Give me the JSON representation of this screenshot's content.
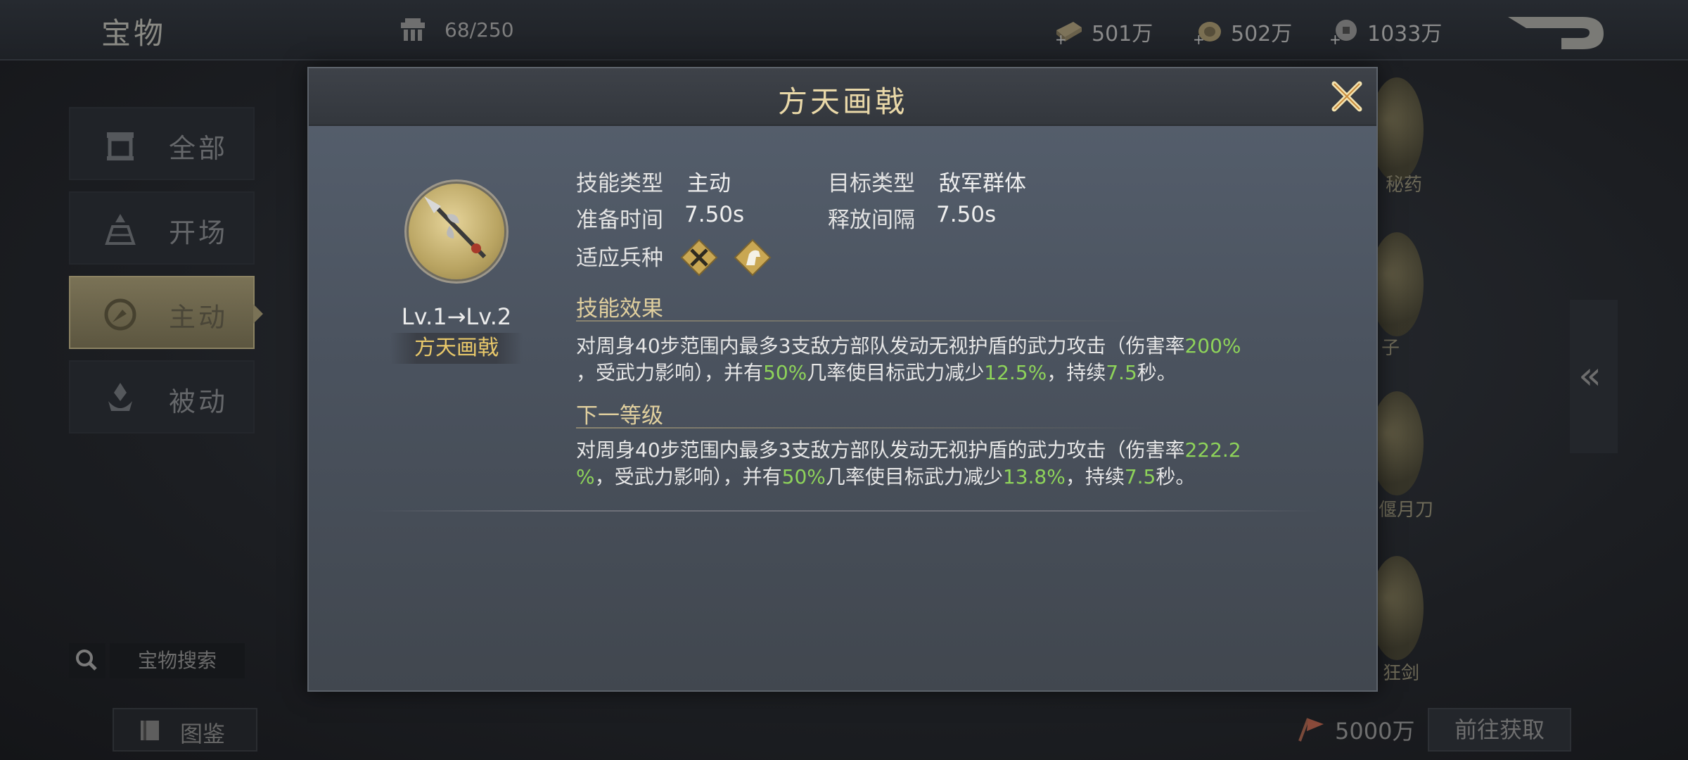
{
  "topbar": {
    "title": "宝物",
    "capacity": "68/250",
    "resources": [
      {
        "icon": "gold-bar-plus-icon",
        "value": "501万"
      },
      {
        "icon": "coin-bag-plus-icon",
        "value": "502万"
      },
      {
        "icon": "copper-coin-plus-icon",
        "value": "1033万"
      }
    ]
  },
  "sidebar": {
    "tabs": [
      {
        "label": "全部",
        "icon": "all-category-icon",
        "active": false
      },
      {
        "label": "开场",
        "icon": "opening-category-icon",
        "active": false
      },
      {
        "label": "主动",
        "icon": "active-category-icon",
        "active": true
      },
      {
        "label": "被动",
        "icon": "passive-category-icon",
        "active": false
      }
    ],
    "search_label": "宝物搜索",
    "codex_label": "图鉴"
  },
  "right_column": {
    "labels": [
      "秘药",
      "子",
      "偃月刀",
      "狂剑"
    ]
  },
  "bottom": {
    "cost": "5000万",
    "goto_label": "前往获取"
  },
  "modal": {
    "title": "方天画戟",
    "level_change": "Lv.1→Lv.2",
    "item_name": "方天画戟",
    "skill_type_label": "技能类型",
    "skill_type": "主动",
    "target_type_label": "目标类型",
    "target_type": "敌军群体",
    "prep_time_label": "准备时间",
    "prep_time": "7.50s",
    "interval_label": "释放间隔",
    "interval": "7.50s",
    "units_label": "适应兵种",
    "unit_icons": [
      "crossed-swords-icon",
      "horse-head-icon"
    ],
    "effect_title": "技能效果",
    "effect": {
      "t1": "对周身40步范围内最多3支敌方部队发动无视护盾的武力攻击（伤害率",
      "g1": "200%",
      "t2": "，受武力影响），并有",
      "g2": "50%",
      "t3": "几率使目标武力减少",
      "g3": "12.5%",
      "t4": "，持续",
      "g4": "7.5",
      "t5": "秒。"
    },
    "next_title": "下一等级",
    "next": {
      "t1": "对周身40步范围内最多3支敌方部队发动无视护盾的武力攻击（伤害率",
      "g1": "222.2",
      "g1b": "%",
      "t2": "，受武力影响），并有",
      "g2": "50%",
      "t3": "几率使目标武力减少",
      "g3": "13.8%",
      "t4": "，持续",
      "g4": "7.5",
      "t5": "秒。"
    }
  },
  "colors": {
    "accent_gold": "#e8c86a",
    "highlight_green": "#8ed35a"
  }
}
